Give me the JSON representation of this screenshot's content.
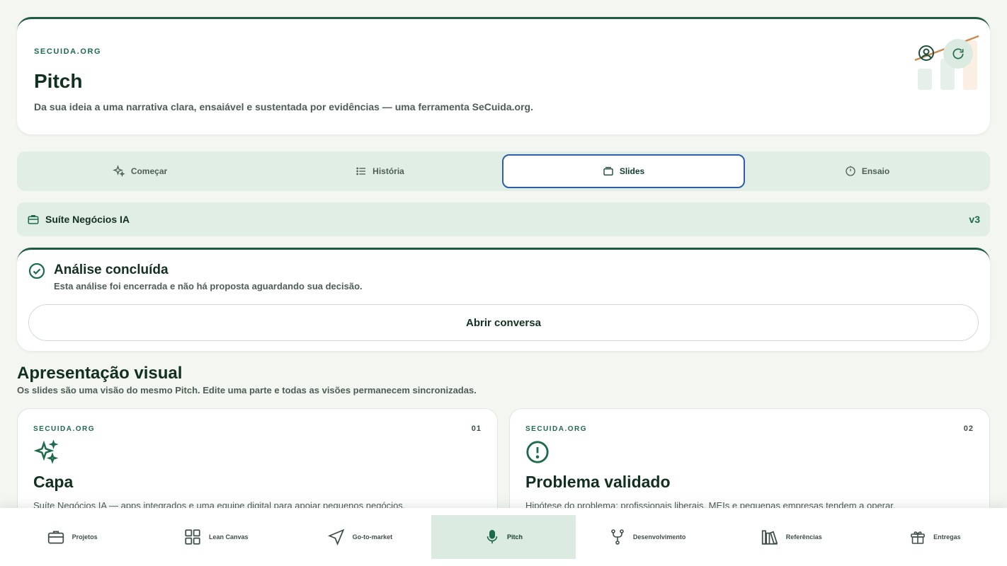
{
  "header": {
    "brand": "SECUIDA.ORG",
    "title": "Pitch",
    "subtitle": "Da sua ideia a uma narrativa clara, ensaiável e sustentada por evidências — uma ferramenta SeCuida.org.",
    "user_icon": "user-circle-icon",
    "refresh_icon": "refresh-icon"
  },
  "tabs": [
    {
      "label": "Começar",
      "icon": "sparkles-icon",
      "active": false
    },
    {
      "label": "História",
      "icon": "list-icon",
      "active": false
    },
    {
      "label": "Slides",
      "icon": "slides-icon",
      "active": true
    },
    {
      "label": "Ensaio",
      "icon": "timer-icon",
      "active": false
    }
  ],
  "project": {
    "name": "Suíte Negócios IA",
    "version": "v3",
    "icon": "briefcase-icon"
  },
  "analysis": {
    "title": "Análise concluída",
    "description": "Esta análise foi encerrada e não há proposta aguardando sua decisão.",
    "button_label": "Abrir conversa",
    "icon": "check-circle-icon"
  },
  "section": {
    "title": "Apresentação visual",
    "subtitle": "Os slides são uma visão do mesmo Pitch. Edite uma parte e todas as visões permanecem sincronizadas."
  },
  "slides": [
    {
      "brand": "SECUIDA.ORG",
      "number": "01",
      "title": "Capa",
      "icon": "sparkles-icon",
      "text": "Suíte Negócios IA — apps integrados e uma equipe digital para apoiar pequenos negócios."
    },
    {
      "brand": "SECUIDA.ORG",
      "number": "02",
      "title": "Problema validado",
      "icon": "alert-circle-icon",
      "text": "Hipótese do problema: profissionais liberais, MEIs e pequenas empresas tendem a operar."
    }
  ],
  "nav": [
    {
      "label": "Projetos",
      "icon": "briefcase-icon",
      "active": false
    },
    {
      "label": "Lean Canvas",
      "icon": "grid-icon",
      "active": false
    },
    {
      "label": "Go-to-market",
      "icon": "navigation-icon",
      "active": false
    },
    {
      "label": "Pitch",
      "icon": "microphone-icon",
      "active": true
    },
    {
      "label": "Desenvolvimento",
      "icon": "git-branch-icon",
      "active": false
    },
    {
      "label": "Referências",
      "icon": "library-icon",
      "active": false
    },
    {
      "label": "Entregas",
      "icon": "gift-icon",
      "active": false
    }
  ],
  "colors": {
    "accent": "#1d6b4a",
    "tab_active_border": "#2d5fa8",
    "soft_green": "#e0eee5",
    "background": "#f4f6f1"
  }
}
